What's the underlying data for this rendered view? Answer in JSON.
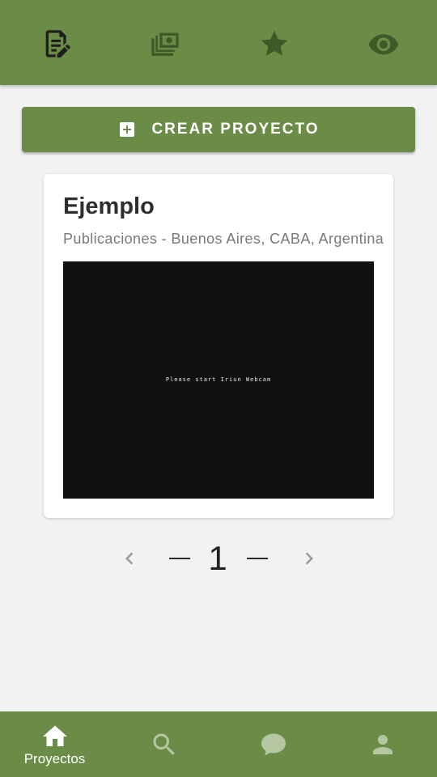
{
  "top_tabs": [
    {
      "icon": "edit-document-icon",
      "active": true
    },
    {
      "icon": "money-stack-icon",
      "active": false
    },
    {
      "icon": "star-icon",
      "active": false
    },
    {
      "icon": "eye-icon",
      "active": false
    }
  ],
  "create_button": {
    "label": "CREAR PROYECTO",
    "icon": "add-box-icon"
  },
  "project_card": {
    "title": "Ejemplo",
    "subtitle": "Publicaciones - Buenos Aires, CABA, Argentina",
    "media_text": "Please start Iriun Webcam"
  },
  "pagination": {
    "current_page": "1"
  },
  "bottom_nav": [
    {
      "icon": "home-icon",
      "label": "Proyectos",
      "active": true
    },
    {
      "icon": "search-icon",
      "label": "",
      "active": false
    },
    {
      "icon": "chat-icon",
      "label": "",
      "active": false
    },
    {
      "icon": "person-icon",
      "label": "",
      "active": false
    }
  ],
  "colors": {
    "primary": "#6b8c47",
    "active_icon": "#1c1c1c",
    "inactive_icon": "#3d5a28",
    "background": "#f2f2f2"
  }
}
